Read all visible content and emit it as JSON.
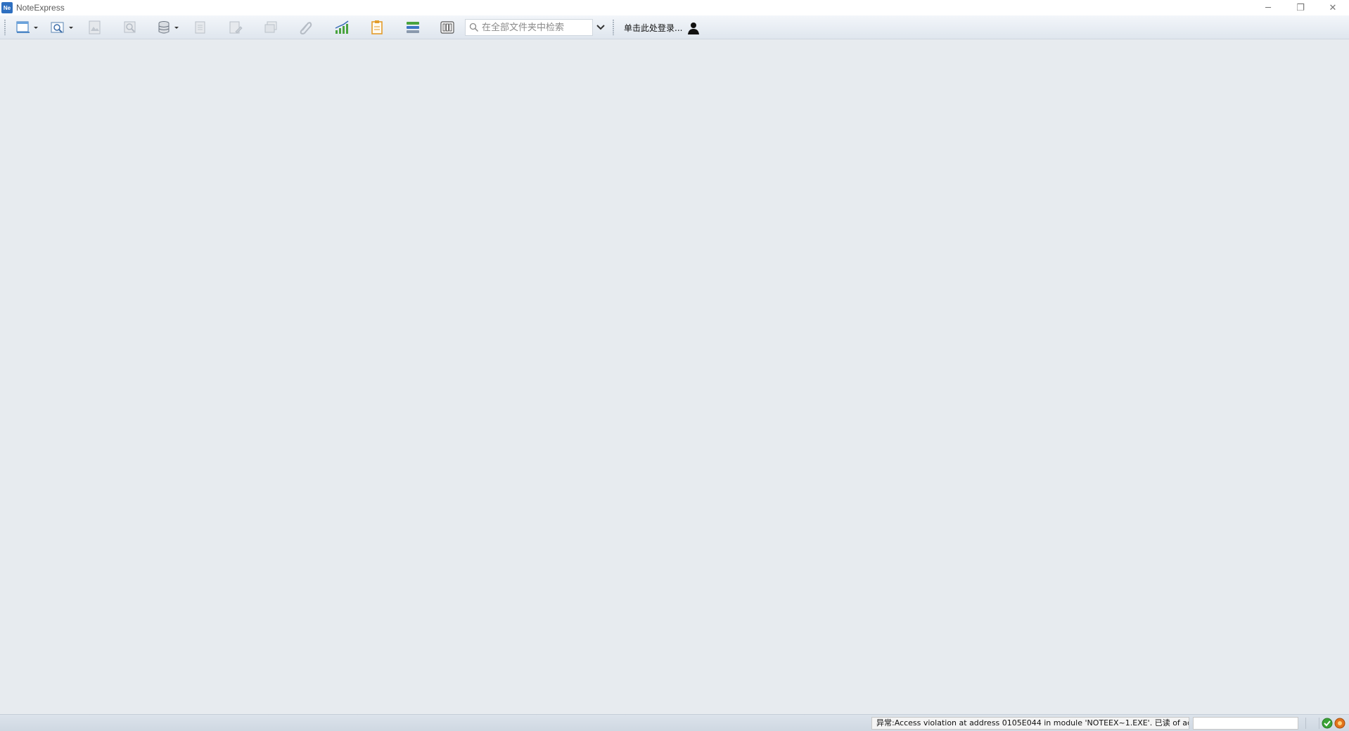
{
  "window": {
    "title": "NoteExpress",
    "icon_label": "Ne"
  },
  "window_controls": {
    "minimize": "─",
    "restore": "❐",
    "close": "✕"
  },
  "toolbar": {
    "search": {
      "placeholder": "在全部文件夹中检索",
      "value": ""
    },
    "login_label": "单击此处登录...",
    "buttons": [
      {
        "name": "new-folder-icon",
        "enabled": true,
        "dropdown": true
      },
      {
        "name": "search-preview-icon",
        "enabled": true,
        "dropdown": true
      },
      {
        "name": "image-icon",
        "enabled": false
      },
      {
        "name": "find-icon",
        "enabled": false
      },
      {
        "name": "database-icon",
        "enabled": true,
        "dropdown": true
      },
      {
        "name": "document-icon",
        "enabled": false
      },
      {
        "name": "edit-document-icon",
        "enabled": false
      },
      {
        "name": "stack-icon",
        "enabled": false
      },
      {
        "name": "attachment-icon",
        "enabled": false
      },
      {
        "name": "bar-chart-icon",
        "enabled": true
      },
      {
        "name": "clipboard-icon",
        "enabled": true
      },
      {
        "name": "layers-icon",
        "enabled": true
      },
      {
        "name": "columns-icon",
        "enabled": true
      }
    ]
  },
  "statusbar": {
    "message": "异常:Access violation at address 0105E044 in module 'NOTEEX~1.EXE'. 已读 of address",
    "field_value": ""
  },
  "colors": {
    "background": "#e7ebef",
    "accent": "#2e6fc0",
    "ok_green": "#3aa335",
    "warn_orange": "#e2731c"
  }
}
